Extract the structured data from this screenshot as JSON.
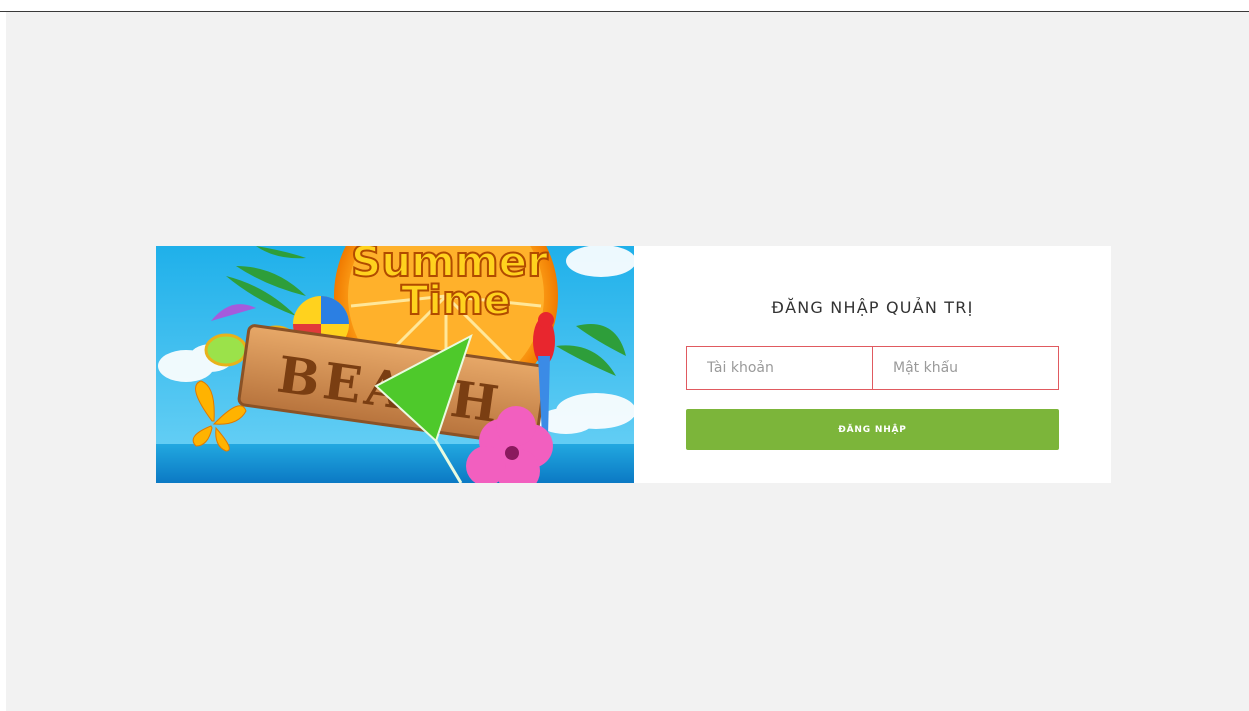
{
  "banner": {
    "headline_line1": "Summer",
    "headline_line2": "Time",
    "sign_text": "BEACH"
  },
  "login": {
    "title": "ĐĂNG NHẬP QUẢN TRỊ",
    "username_placeholder": "Tài khoản",
    "password_placeholder": "Mật khẩu",
    "submit_label": "ĐĂNG NHẬP"
  },
  "colors": {
    "page_background": "#f2f2f2",
    "card_background": "#ffffff",
    "input_border": "#e05a60",
    "button_background": "#7cb53a",
    "sky": "#33b9ec"
  }
}
